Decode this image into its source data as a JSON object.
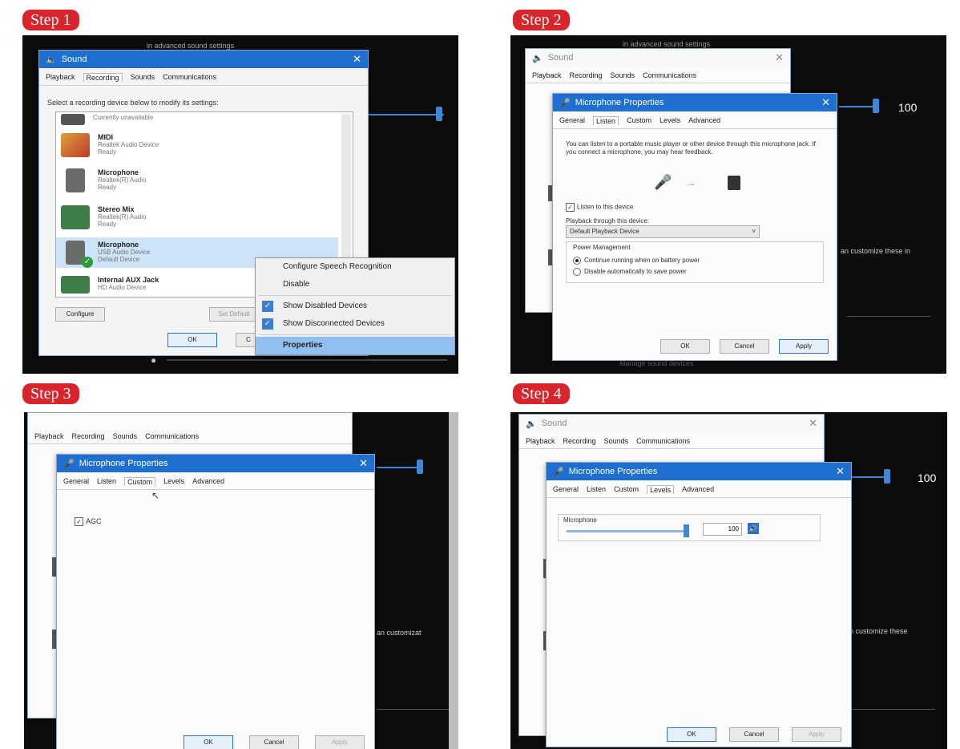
{
  "steps": {
    "step1": {
      "badge": "Step 1",
      "bg_text": "in advanced sound settings",
      "sound_title": "Sound",
      "tabs": [
        "Playback",
        "Recording",
        "Sounds",
        "Communications"
      ],
      "instruction": "Select a recording device below to modify its settings:",
      "devices": [
        {
          "name": "",
          "sub1": "Currently unavailable",
          "sub2": ""
        },
        {
          "name": "MIDI",
          "sub1": "Realtek Audio Device",
          "sub2": "Ready"
        },
        {
          "name": "Microphone",
          "sub1": "Realtek(R) Audio",
          "sub2": "Ready"
        },
        {
          "name": "Stereo Mix",
          "sub1": "Realtek(R) Audio",
          "sub2": "Ready"
        },
        {
          "name": "Microphone",
          "sub1": "USB Audio Device",
          "sub2": "Default Device"
        },
        {
          "name": "Internal AUX Jack",
          "sub1": "HD Audio Device",
          "sub2": "Ready"
        }
      ],
      "configure_btn": "Configure",
      "set_default_btn": "Set Default",
      "ok_btn": "OK",
      "cancel_btn": "C",
      "menu": [
        "Configure Speech Recognition",
        "Disable",
        "Show Disabled Devices",
        "Show Disconnected Devices",
        "Properties"
      ]
    },
    "step2": {
      "badge": "Step 2",
      "bg_text": "in advanced sound settings",
      "volume": "100",
      "bg_text2": "an customize these in",
      "bg_text3": "Manage sound devices",
      "sound_title": "Sound",
      "tabs_bg": [
        "Playback",
        "Recording",
        "Sounds",
        "Communications"
      ],
      "mic_title": "Microphone Properties",
      "tabs": [
        "General",
        "Listen",
        "Custom",
        "Levels",
        "Advanced"
      ],
      "desc": "You can listen to a portable music player or other device through this microphone jack. If you connect a microphone, you may hear feedback.",
      "listen_label": "Listen to this device",
      "playback_label": "Playback through this device:",
      "playback_value": "Default Playback Device",
      "power_title": "Power Management",
      "radio1": "Continue running when on battery power",
      "radio2": "Disable automatically to save power",
      "ok_btn": "OK",
      "cancel_btn": "Cancel",
      "apply_btn": "Apply"
    },
    "step3": {
      "badge": "Step 3",
      "tabs_bg": [
        "Playback",
        "Recording",
        "Sounds",
        "Communications"
      ],
      "mic_title": "Microphone Properties",
      "tabs": [
        "General",
        "Listen",
        "Custom",
        "Levels",
        "Advanced"
      ],
      "agc_label": "AGC",
      "bg_text": "an customizat",
      "ok_btn": "OK",
      "cancel_btn": "Cancel",
      "apply_btn": "Apply"
    },
    "step4": {
      "badge": "Step 4",
      "sound_title": "Sound",
      "tabs_bg": [
        "Playback",
        "Recording",
        "Sounds",
        "Communications"
      ],
      "mic_title": "Microphone Properties",
      "tabs": [
        "General",
        "Listen",
        "Custom",
        "Levels",
        "Advanced"
      ],
      "level_label": "Microphone",
      "level_value": "100",
      "level_fraction": 1.0,
      "volume": "100",
      "bg_text": "an customize these",
      "ok_btn": "OK",
      "cancel_btn": "Cancel",
      "apply_btn": "Apply"
    }
  },
  "colors": {
    "badge": "#d8252b",
    "titlebar": "#1e6fd0",
    "accent": "#3d86d8"
  },
  "icons": [
    "speaker-icon",
    "midi-cable-icon",
    "microphone-icon",
    "sound-card-icon",
    "default-check-icon",
    "mouse-cursor-icon",
    "speaker-output-icon",
    "arrow-icon"
  ]
}
